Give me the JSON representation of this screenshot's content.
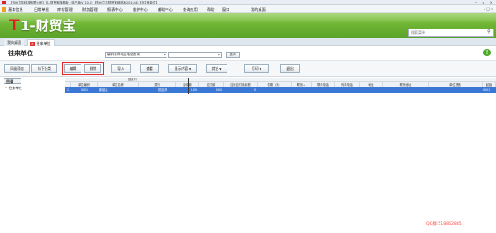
{
  "window": {
    "title": "【郑州立华科技有限公司】T1-财贸宝旗舰版（单户版 V 10.0）【郑州立华财贸宝网络版2014(4) 】·【往来单位】",
    "controls": "－ ▫ ×"
  },
  "menu": [
    "基本信息",
    "日常单据",
    "库存管理",
    "财务管理",
    "报表中心",
    "维护中心",
    "辅助中心",
    "查询应用",
    "帮助",
    "窗口",
    "我的桌面"
  ],
  "menu_right": "- □ ×",
  "logo": {
    "t": "T",
    "rest": "1-财贸宝"
  },
  "search": {
    "placeholder": "搜索菜单",
    "icon": "search-icon"
  },
  "tabs": [
    {
      "label": "我的桌面"
    },
    {
      "label": "往来单位",
      "close": "×"
    }
  ],
  "page": {
    "title": "往来单位",
    "filter_select": "编码名称地址电话查询",
    "filter_select2": "",
    "query_label": "查询",
    "help_icon": "!"
  },
  "toolbar": {
    "buttons": [
      {
        "label": "同级添加"
      },
      {
        "label": "向下分类"
      },
      {
        "label": "编辑"
      },
      {
        "label": "删除"
      },
      {
        "label": "导入"
      },
      {
        "label": "查看"
      },
      {
        "label": "显示内容",
        "dd": "▼"
      },
      {
        "label": "其它",
        "dd": "▼"
      },
      {
        "label": "打印",
        "dd": "▼"
      },
      {
        "label": "退出"
      }
    ]
  },
  "tree": {
    "header": "目录",
    "items": [
      "往来单位"
    ]
  },
  "grid": {
    "group_header": "固定列",
    "columns": [
      "",
      "单位编码",
      "单位名称",
      "类别",
      "应收款",
      "应付款",
      "应收应付款余额",
      "保期（天）",
      "联系人",
      "联系电话",
      "传真电话",
      "地址",
      "联系地址",
      "单位拼音",
      "起始"
    ],
    "rows": [
      [
        "1",
        "0001",
        "新起点",
        "供应商",
        "0.00",
        "0.00",
        "0",
        "",
        "",
        "",
        "",
        "",
        "",
        "",
        "0001"
      ]
    ]
  },
  "watermark": "QQ群:518862885"
}
